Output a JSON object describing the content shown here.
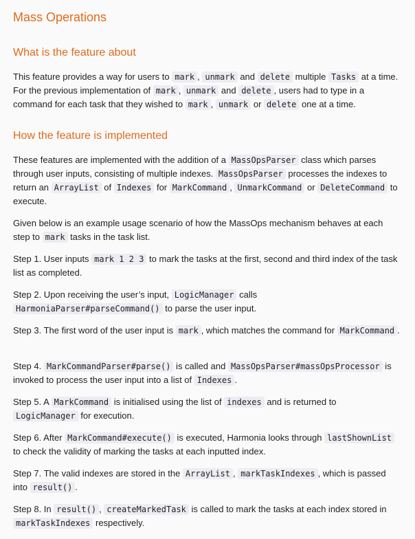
{
  "title": "Mass Operations",
  "section1": {
    "heading": "What is the feature about",
    "p1": [
      {
        "t": "This feature provides a way for users to "
      },
      {
        "c": "mark"
      },
      {
        "t": ", "
      },
      {
        "c": "unmark"
      },
      {
        "t": " and "
      },
      {
        "c": "delete"
      },
      {
        "t": " multiple "
      },
      {
        "c": "Tasks"
      },
      {
        "t": " at a time. For the previous implementation of "
      },
      {
        "c": "mark"
      },
      {
        "t": ", "
      },
      {
        "c": "unmark"
      },
      {
        "t": " and "
      },
      {
        "c": "delete"
      },
      {
        "t": ", users had to type in a command for each task that they wished to "
      },
      {
        "c": "mark"
      },
      {
        "t": ", "
      },
      {
        "c": "unmark"
      },
      {
        "t": " or "
      },
      {
        "c": "delete"
      },
      {
        "t": " one at a time."
      }
    ]
  },
  "section2": {
    "heading": "How the feature is implemented",
    "paragraphs": [
      [
        {
          "t": "These features are implemented with the addition of a "
        },
        {
          "c": "MassOpsParser"
        },
        {
          "t": " class which parses through user inputs, consisting of multiple indexes. "
        },
        {
          "c": "MassOpsParser"
        },
        {
          "t": " processes the indexes to return an "
        },
        {
          "c": "ArrayList"
        },
        {
          "t": " of "
        },
        {
          "c": "Indexes"
        },
        {
          "t": " for "
        },
        {
          "c": "MarkCommand"
        },
        {
          "t": ", "
        },
        {
          "c": "UnmarkCommand"
        },
        {
          "t": " or "
        },
        {
          "c": "DeleteCommand"
        },
        {
          "t": " to execute."
        }
      ],
      [
        {
          "t": "Given below is an example usage scenario of how the MassOps mechanism behaves at each step to "
        },
        {
          "c": "mark"
        },
        {
          "t": " tasks in the task list."
        }
      ],
      [
        {
          "t": "Step 1. User inputs "
        },
        {
          "c": "mark 1 2 3"
        },
        {
          "t": " to mark the tasks at the first, second and third index of the task list as completed."
        }
      ],
      [
        {
          "t": "Step 2. Upon receiving the user’s input, "
        },
        {
          "c": "LogicManager"
        },
        {
          "t": " calls "
        },
        {
          "c": "HarmoniaParser#parseCommand()"
        },
        {
          "t": " to parse the user input."
        }
      ],
      [
        {
          "t": "Step 3. The first word of the user input is "
        },
        {
          "c": "mark"
        },
        {
          "t": ", which matches the command for "
        },
        {
          "c": "MarkCommand"
        },
        {
          "t": "."
        }
      ],
      [
        {
          "t": "Step 4. "
        },
        {
          "c": "MarkCommandParser#parse()"
        },
        {
          "t": " is called and "
        },
        {
          "c": "MassOpsParser#massOpsProcessor"
        },
        {
          "t": " is invoked to process the user input into a list of "
        },
        {
          "c": "Indexes"
        },
        {
          "t": "."
        }
      ],
      [
        {
          "t": "Step 5. A "
        },
        {
          "c": "MarkCommand"
        },
        {
          "t": " is initialised using the list of "
        },
        {
          "c": "indexes"
        },
        {
          "t": " and is returned to "
        },
        {
          "c": "LogicManager"
        },
        {
          "t": " for execution."
        }
      ],
      [
        {
          "t": "Step 6. After "
        },
        {
          "c": "MarkCommand#execute()"
        },
        {
          "t": " is executed, Harmonia looks through "
        },
        {
          "c": "lastShownList"
        },
        {
          "t": " to check the validity of marking the tasks at each inputted index."
        }
      ],
      [
        {
          "t": "Step 7. The valid indexes are stored in the "
        },
        {
          "c": "ArrayList"
        },
        {
          "t": ", "
        },
        {
          "c": "markTaskIndexes"
        },
        {
          "t": ", which is passed into "
        },
        {
          "c": "result()"
        },
        {
          "t": "."
        }
      ],
      [
        {
          "t": "Step 8. In "
        },
        {
          "c": "result()"
        },
        {
          "t": ", "
        },
        {
          "c": "createMarkedTask"
        },
        {
          "t": " is called to mark the tasks at each index stored in "
        },
        {
          "c": "markTaskIndexes"
        },
        {
          "t": " respectively."
        }
      ]
    ]
  }
}
